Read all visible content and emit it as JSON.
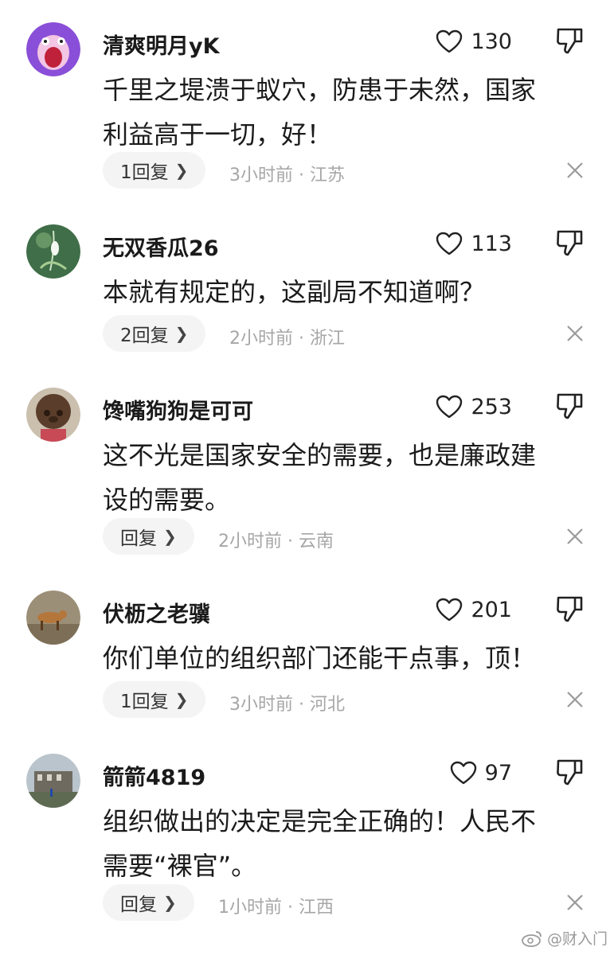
{
  "comments": [
    {
      "username": "清爽明月yK",
      "likes": "130",
      "lines": [
        "千里之堤溃于蚁穴，防患于未然，国家",
        "利益高于一切，好！"
      ],
      "reply_label": "1回复",
      "time_location": "3小时前 · 江苏"
    },
    {
      "username": "无双香瓜26",
      "likes": "113",
      "lines": [
        "本就有规定的，这副局不知道啊？"
      ],
      "reply_label": "2回复",
      "time_location": "2小时前 · 浙江"
    },
    {
      "username": "馋嘴狗狗是可可",
      "likes": "253",
      "lines": [
        "这不光是国家安全的需要，也是廉政建",
        "设的需要。"
      ],
      "reply_label": "回复",
      "time_location": "2小时前 · 云南"
    },
    {
      "username": "伏枥之老骥",
      "likes": "201",
      "lines": [
        "你们单位的组织部门还能干点事，顶！"
      ],
      "reply_label": "1回复",
      "time_location": "3小时前 · 河北"
    },
    {
      "username": "箭箭4819",
      "likes": "97",
      "lines": [
        "组织做出的决定是完全正确的！人民不",
        "需要“裸官”。"
      ],
      "reply_label": "回复",
      "time_location": "1小时前 · 江西"
    }
  ],
  "watermark": "@财入门",
  "icons": {
    "like": "heart-outline-icon",
    "dislike": "thumbs-down-icon",
    "dismiss": "close-icon",
    "reply_chevron": "chevron-right-icon"
  }
}
